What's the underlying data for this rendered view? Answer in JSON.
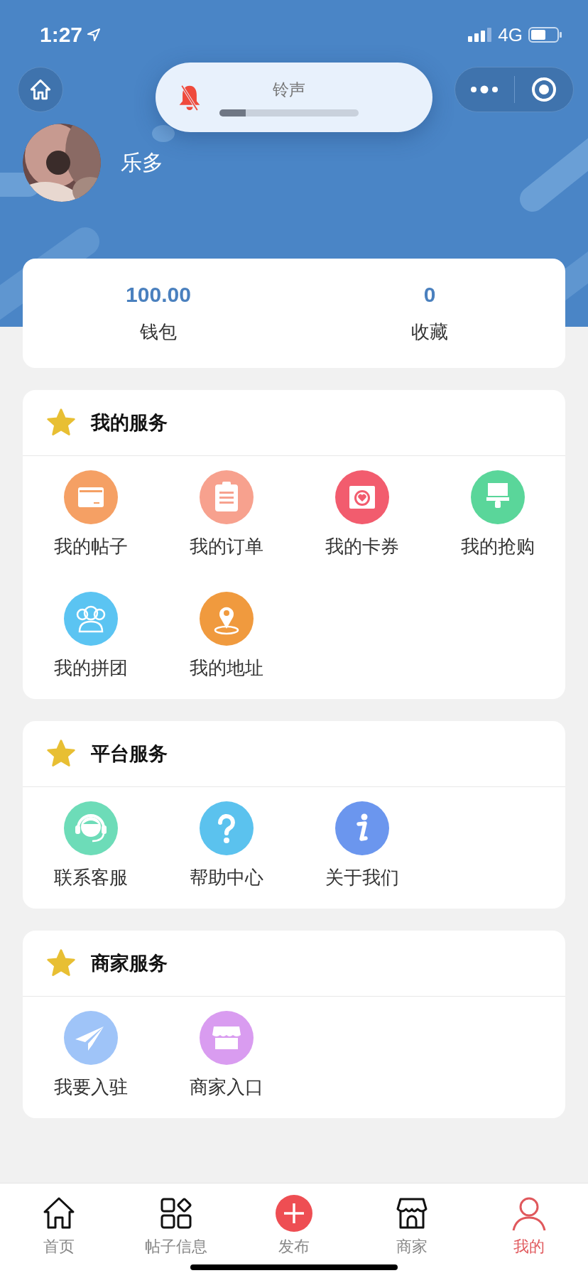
{
  "status_bar": {
    "time": "1:27",
    "network": "4G"
  },
  "volume_popup": {
    "label": "铃声",
    "muted": true,
    "level": 0.19
  },
  "profile": {
    "name": "乐多"
  },
  "stats": [
    {
      "value": "100.00",
      "label": "钱包"
    },
    {
      "value": "0",
      "label": "收藏"
    }
  ],
  "sections": [
    {
      "title": "我的服务",
      "items": [
        {
          "label": "我的帖子",
          "color": "#f5a064"
        },
        {
          "label": "我的订单",
          "color": "#f7a18e"
        },
        {
          "label": "我的卡券",
          "color": "#f25c6e"
        },
        {
          "label": "我的抢购",
          "color": "#5ad69a"
        },
        {
          "label": "我的拼团",
          "color": "#5bc4f2"
        },
        {
          "label": "我的地址",
          "color": "#f09a3e"
        }
      ]
    },
    {
      "title": "平台服务",
      "items": [
        {
          "label": "联系客服",
          "color": "#6ddcb8"
        },
        {
          "label": "帮助中心",
          "color": "#5bc2ee"
        },
        {
          "label": "关于我们",
          "color": "#6b96ee"
        }
      ]
    },
    {
      "title": "商家服务",
      "items": [
        {
          "label": "我要入驻",
          "color": "#9fc4f8"
        },
        {
          "label": "商家入口",
          "color": "#d99cf0"
        }
      ]
    }
  ],
  "tab_bar": [
    {
      "label": "首页",
      "selected": false
    },
    {
      "label": "帖子信息",
      "selected": false
    },
    {
      "label": "发布",
      "selected": false
    },
    {
      "label": "商家",
      "selected": false
    },
    {
      "label": "我的",
      "selected": true
    }
  ]
}
